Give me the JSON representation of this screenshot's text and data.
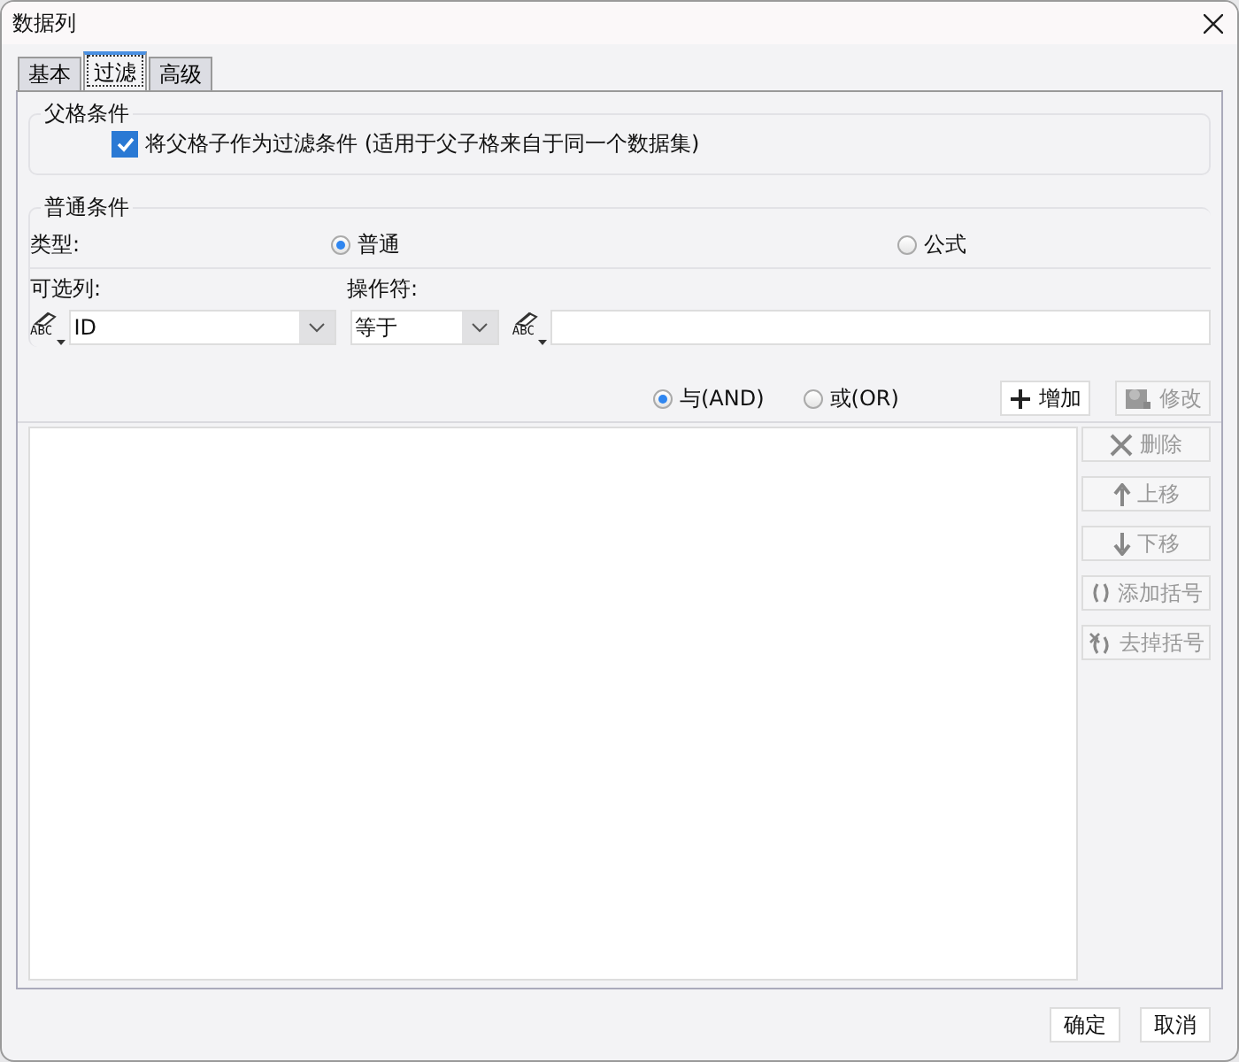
{
  "window": {
    "title": "数据列"
  },
  "tabs": [
    {
      "label": "基本",
      "selected": false
    },
    {
      "label": "过滤",
      "selected": true
    },
    {
      "label": "高级",
      "selected": false
    }
  ],
  "parent_condition": {
    "title": "父格条件",
    "checkbox": {
      "label": "将父格子作为过滤条件 (适用于父子格来自于同一个数据集)",
      "checked": true
    }
  },
  "normal_condition": {
    "title": "普通条件",
    "type_label": "类型:",
    "type_options": [
      {
        "label": "普通",
        "selected": true
      },
      {
        "label": "公式",
        "selected": false
      }
    ],
    "column_label": "可选列:",
    "operator_label": "操作符:",
    "column_icon_text": "ABC",
    "column_value": "ID",
    "operator_value": "等于",
    "value_icon_text": "ABC"
  },
  "logic": [
    {
      "label": "与(AND)",
      "selected": true
    },
    {
      "label": "或(OR)",
      "selected": false
    }
  ],
  "actions": [
    {
      "kind": "add",
      "label": "增加",
      "disabled": false
    },
    {
      "kind": "edit",
      "label": "修改",
      "disabled": true
    }
  ],
  "side_buttons": [
    {
      "kind": "delete",
      "label": "删除",
      "disabled": true
    },
    {
      "kind": "up",
      "label": "上移",
      "disabled": true
    },
    {
      "kind": "down",
      "label": "下移",
      "disabled": true
    },
    {
      "kind": "add-bracket",
      "label": "添加括号",
      "disabled": true
    },
    {
      "kind": "remove-bracket",
      "label": "去掉括号",
      "disabled": true
    }
  ],
  "footer": [
    {
      "label": "确定"
    },
    {
      "label": "取消"
    }
  ]
}
